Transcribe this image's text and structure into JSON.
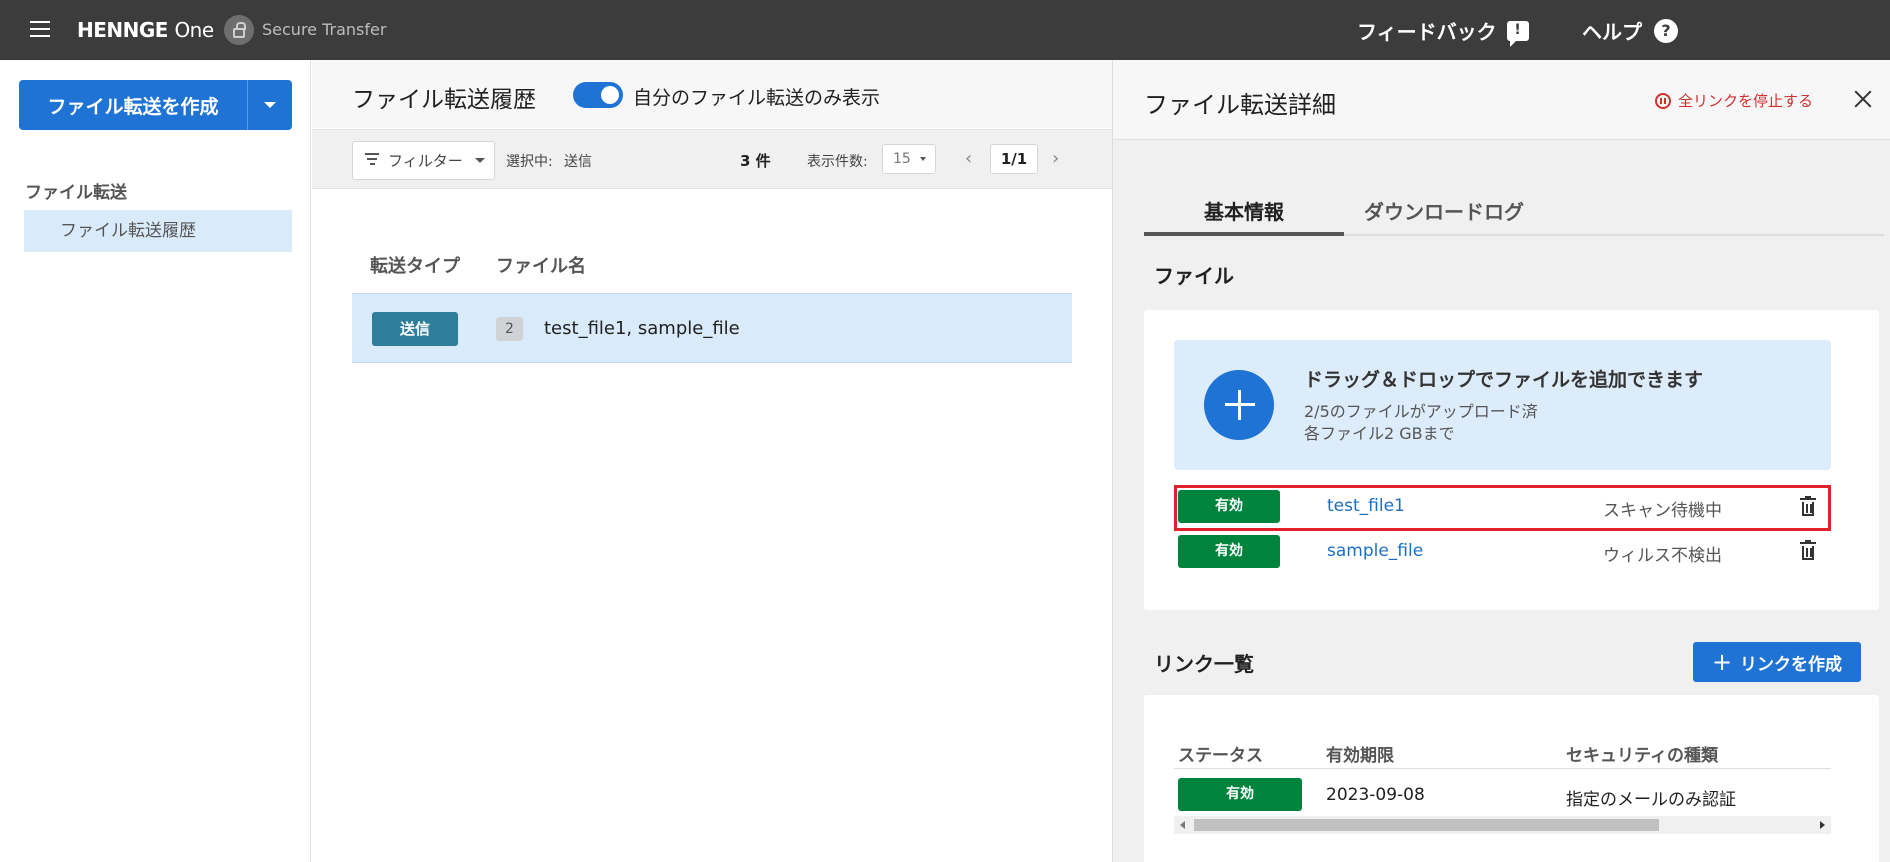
{
  "header": {
    "brand": "HENNGE",
    "brand_one": "One",
    "product": "Secure Transfer",
    "feedback": "フィードバック",
    "feedback_icon": "!",
    "help": "ヘルプ",
    "help_icon": "?"
  },
  "sidebar": {
    "create_button": "ファイル転送を作成",
    "section": "ファイル転送",
    "items": [
      {
        "label": "ファイル転送履歴"
      }
    ]
  },
  "history": {
    "title": "ファイル転送履歴",
    "toggle_label": "自分のファイル転送のみ表示",
    "toggle_on": true,
    "filter_label": "フィルター",
    "selected_label": "選択中:",
    "selected_value": "送信",
    "count": "3 件",
    "per_page_label": "表示件数:",
    "per_page_value": "15",
    "page": "1/1",
    "prev_icon": "‹",
    "next_icon": "›",
    "columns": [
      "転送タイプ",
      "ファイル名"
    ],
    "rows": [
      {
        "type": "送信",
        "file_count": "2",
        "files": "test_file1, sample_file"
      }
    ]
  },
  "detail": {
    "title": "ファイル転送詳細",
    "stop_all": "全リンクを停止する",
    "tabs": [
      "基本情報",
      "ダウンロードログ"
    ],
    "files_section": "ファイル",
    "dropzone": {
      "title": "ドラッグ＆ドロップでファイルを追加できます",
      "line1": "2/5のファイルがアップロード済",
      "line2": "各ファイル2 GBまで"
    },
    "files": [
      {
        "status_badge": "有効",
        "name": "test_file1",
        "scan": "スキャン待機中"
      },
      {
        "status_badge": "有効",
        "name": "sample_file",
        "scan": "ウィルス不検出"
      }
    ],
    "links_section": "リンク一覧",
    "create_link": "リンクを作成",
    "links_columns": [
      "ステータス",
      "有効期限",
      "セキュリティの種類"
    ],
    "links": [
      {
        "status": "有効",
        "expires": "2023-09-08",
        "security": "指定のメールのみ認証"
      }
    ]
  },
  "colors": {
    "header_bg": "#3c3c3c",
    "primary": "#1e73d4",
    "active_green": "#00843d",
    "highlight_red": "#e0212a",
    "selected_row": "#d9ebfb"
  }
}
